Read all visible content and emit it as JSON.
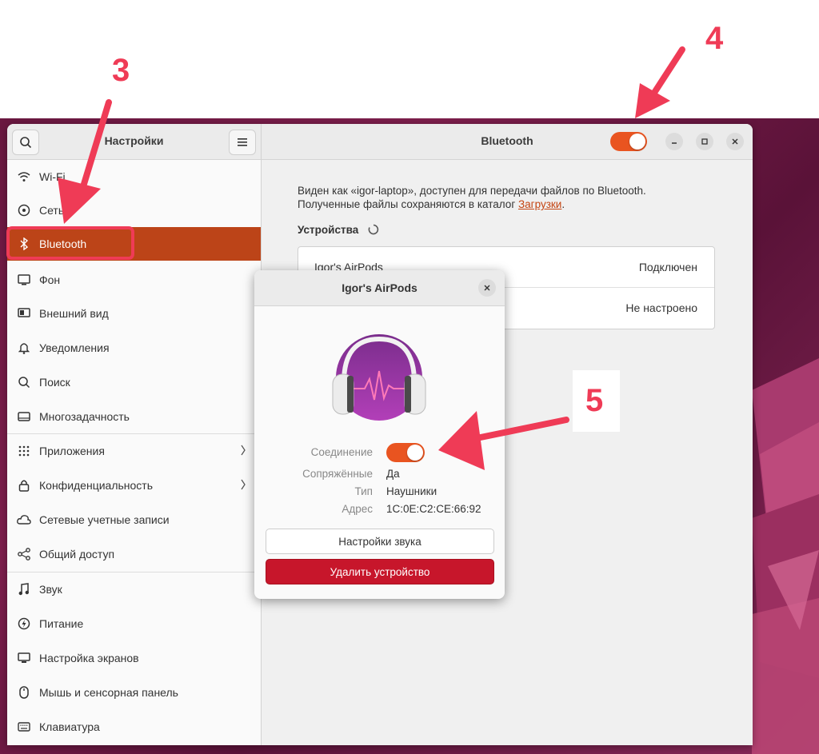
{
  "window": {
    "sidebar_title": "Настройки",
    "main_title": "Bluetooth"
  },
  "sidebar": {
    "items": [
      {
        "label": "Wi-Fi",
        "icon": "wifi-icon"
      },
      {
        "label": "Сеть",
        "icon": "network-icon"
      },
      {
        "label": "Bluetooth",
        "icon": "bluetooth-icon",
        "active": true
      },
      {
        "label": "Фон",
        "icon": "background-icon"
      },
      {
        "label": "Внешний вид",
        "icon": "appearance-icon"
      },
      {
        "label": "Уведомления",
        "icon": "bell-icon"
      },
      {
        "label": "Поиск",
        "icon": "search-icon"
      },
      {
        "label": "Многозадачность",
        "icon": "multitasking-icon"
      },
      {
        "label": "Приложения",
        "icon": "apps-grid-icon",
        "chevron": true
      },
      {
        "label": "Конфиденциальность",
        "icon": "lock-icon",
        "chevron": true
      },
      {
        "label": "Сетевые учетные записи",
        "icon": "cloud-icon"
      },
      {
        "label": "Общий доступ",
        "icon": "share-icon"
      },
      {
        "label": "Звук",
        "icon": "music-note-icon"
      },
      {
        "label": "Питание",
        "icon": "power-icon"
      },
      {
        "label": "Настройка экранов",
        "icon": "display-icon"
      },
      {
        "label": "Мышь и сенсорная панель",
        "icon": "mouse-icon"
      },
      {
        "label": "Клавиатура",
        "icon": "keyboard-icon"
      }
    ]
  },
  "main": {
    "desc_line1": "Виден как «igor-laptop», доступен для передачи файлов по Bluetooth.",
    "desc_line2_prefix": "Полученные файлы сохраняются в каталог ",
    "desc_link": "Загрузки",
    "desc_line2_suffix": ".",
    "devices_heading": "Устройства",
    "devices": [
      {
        "name": "Igor's AirPods",
        "status": "Подключен"
      },
      {
        "name": "",
        "status": "Не настроено"
      }
    ]
  },
  "dialog": {
    "title": "Igor's AirPods",
    "connection_label": "Соединение",
    "paired_label": "Сопряжённые",
    "paired_value": "Да",
    "type_label": "Тип",
    "type_value": "Наушники",
    "address_label": "Адрес",
    "address_value": "1C:0E:C2:CE:66:92",
    "sound_settings_button": "Настройки звука",
    "remove_button": "Удалить устройство"
  },
  "annotations": {
    "n3": "3",
    "n4": "4",
    "n5": "5"
  },
  "colors": {
    "accent": "#e95420",
    "active_bg": "#bc4418",
    "danger": "#c7162b",
    "annotation": "#ef3b56"
  }
}
